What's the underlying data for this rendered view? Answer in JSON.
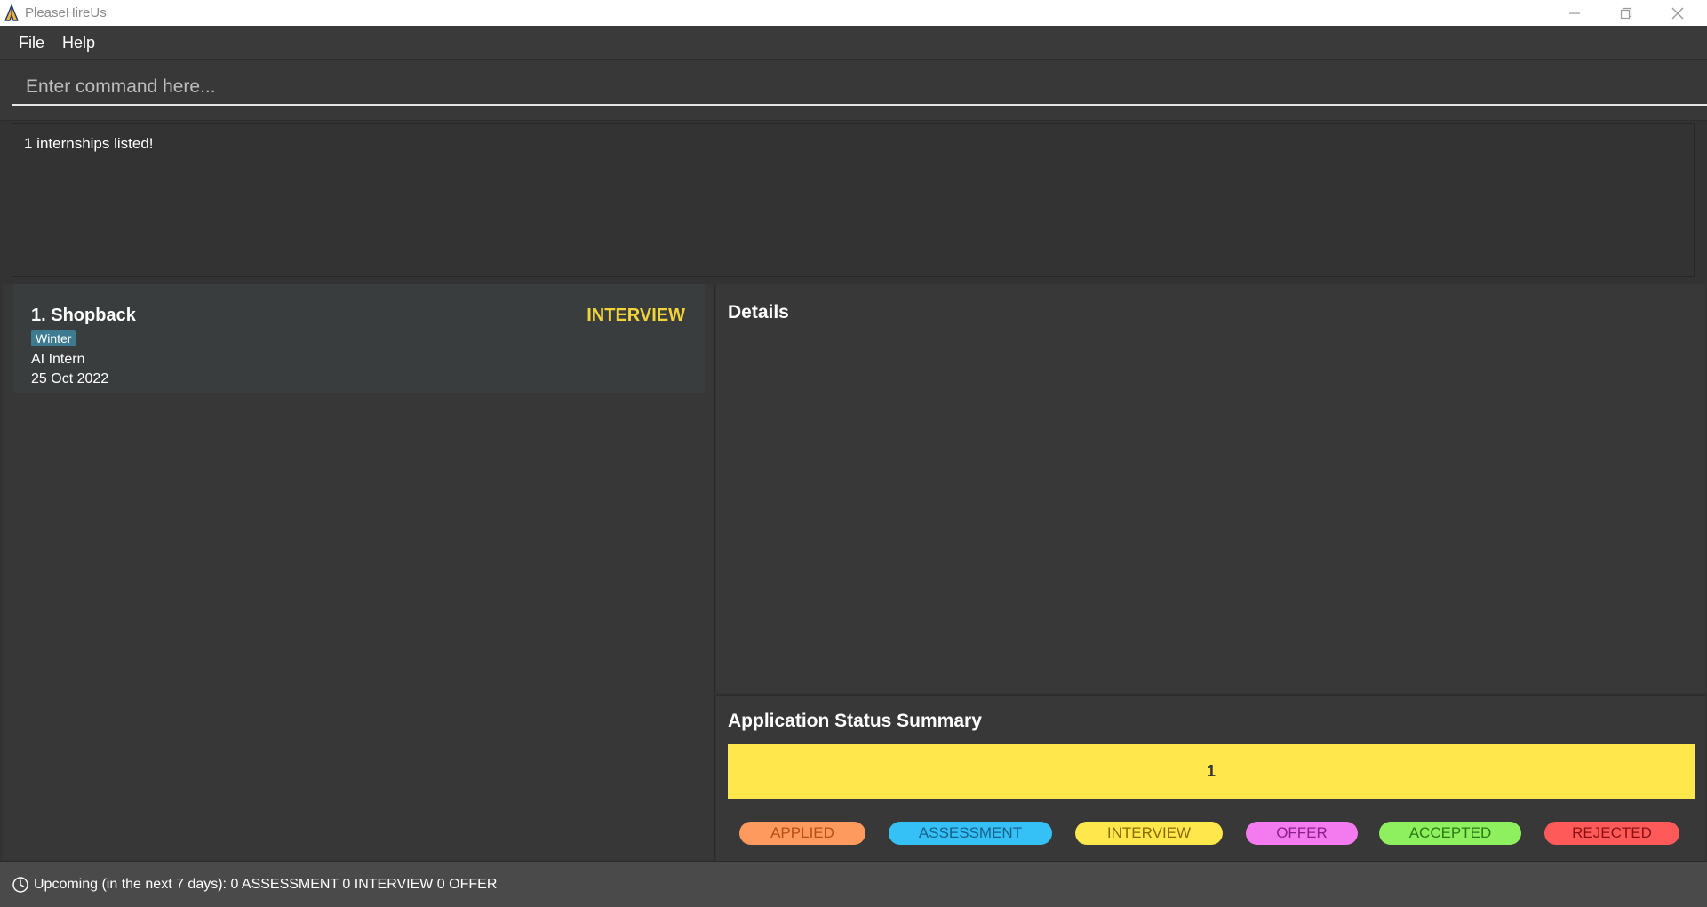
{
  "window": {
    "title": "PleaseHireUs",
    "icon": "praying-hands-icon"
  },
  "menu": {
    "items": [
      "File",
      "Help"
    ]
  },
  "command": {
    "placeholder": "Enter command here..."
  },
  "result": {
    "message": "1 internships listed!"
  },
  "internships": [
    {
      "index_title": "1.  Shopback",
      "status": "INTERVIEW",
      "tag": "Winter",
      "role": "AI Intern",
      "date": "25 Oct 2022"
    }
  ],
  "details": {
    "title": "Details"
  },
  "summary": {
    "title": "Application Status Summary",
    "bar_count": "1",
    "bar_fraction_interview": 1.0,
    "legend": [
      {
        "label": "APPLIED",
        "bg": "#ff9a5e",
        "fg": "#b94d12"
      },
      {
        "label": "ASSESSMENT",
        "bg": "#35c1f5",
        "fg": "#14608a"
      },
      {
        "label": "INTERVIEW",
        "bg": "#ffe74c",
        "fg": "#8d6a00"
      },
      {
        "label": "OFFER",
        "bg": "#f47bef",
        "fg": "#8b1f8a"
      },
      {
        "label": "ACCEPTED",
        "bg": "#8ef05e",
        "fg": "#2b7a14"
      },
      {
        "label": "REJECTED",
        "bg": "#ff5a5a",
        "fg": "#8c1010"
      }
    ]
  },
  "statusbar": {
    "icon": "clock-icon",
    "text": "Upcoming (in the next 7 days):  0 ASSESSMENT 0 INTERVIEW 0 OFFER"
  },
  "colors": {
    "interview_accent": "#f2d43a",
    "tag_bg": "#3e7b91"
  }
}
